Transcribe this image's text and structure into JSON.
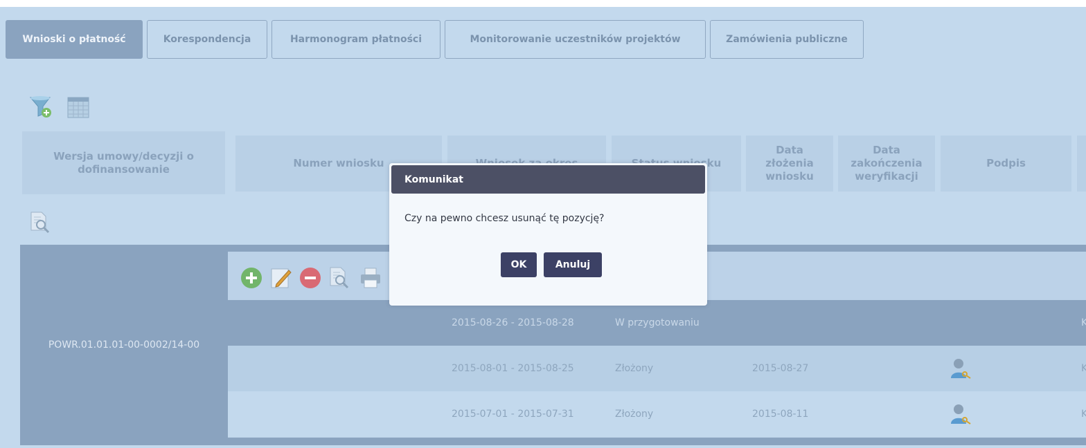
{
  "tabs": [
    {
      "label": "Wnioski o płatność",
      "active": true
    },
    {
      "label": "Korespondencja",
      "active": false
    },
    {
      "label": "Harmonogram płatności",
      "active": false
    },
    {
      "label": "Monitorowanie uczestników projektów",
      "active": false
    },
    {
      "label": "Zamówienia publiczne",
      "active": false
    }
  ],
  "toolbar_icons": [
    "filter-add-icon",
    "table-columns-icon"
  ],
  "table": {
    "headers": {
      "agreement_version": "Wersja umowy/decyzji o dofinansowanie",
      "request_number": "Numer wniosku",
      "period": "Wniosek za okres",
      "status": "Status wniosku",
      "submission_date": "Data złożenia wniosku",
      "verification_end_date": "Data zakończenia weryfikacji",
      "signature": "Podpis"
    },
    "group": {
      "agreement_number": "POWR.01.01.01-00-0002/14-00",
      "actions": [
        "add-icon",
        "edit-icon",
        "remove-icon",
        "preview-icon",
        "print-icon"
      ],
      "rows": [
        {
          "period": "2015-08-26 - 2015-08-28",
          "status": "W przygotowaniu",
          "submission_date": "",
          "signature": false,
          "selected": true,
          "trailing": "K"
        },
        {
          "period": "2015-08-01 - 2015-08-25",
          "status": "Złożony",
          "submission_date": "2015-08-27",
          "signature": true,
          "selected": false,
          "trailing": "K"
        },
        {
          "period": "2015-07-01 - 2015-07-31",
          "status": "Złożony",
          "submission_date": "2015-08-11",
          "signature": true,
          "selected": false,
          "trailing": "K"
        }
      ]
    }
  },
  "dialog": {
    "title": "Komunikat",
    "message": "Czy na pewno chcesz usunąć tę pozycję?",
    "ok_label": "OK",
    "cancel_label": "Anuluj"
  },
  "colors": {
    "background": "#c3d9ed",
    "active_tab": "#8aa3bf",
    "dialog_header": "#4c5065",
    "dialog_button": "#3c4165"
  }
}
